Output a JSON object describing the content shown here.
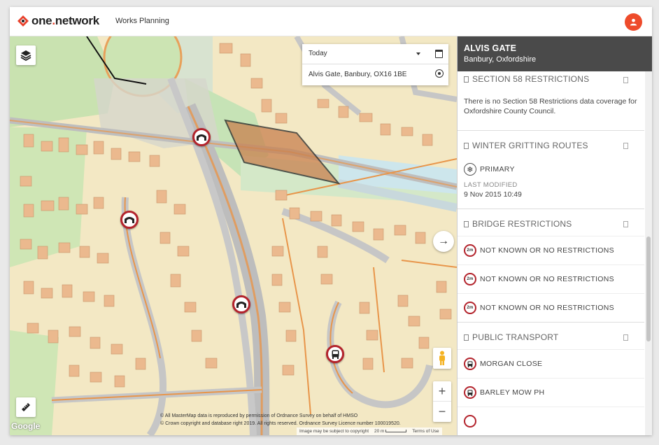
{
  "header": {
    "brand_prefix": "one",
    "brand_dot": ".",
    "brand_suffix": "network",
    "app_name": "Works Planning"
  },
  "search": {
    "date_value": "Today",
    "address_value": "Alvis Gate, Banbury, OX16 1BE"
  },
  "map": {
    "attribution_line1": "© All MasterMap data is reproduced by permission of Ordnance Survey on behalf of HMSO",
    "attribution_line2": "© Crown copyright and database right 2019. All rights reserved. Ordnance Survey Licence number 100019520.",
    "google_label": "Google",
    "footer_notice": "Image may be subject to copyright",
    "scale_label": "20 m",
    "terms_label": "Terms of Use",
    "zoom_in": "+",
    "zoom_out": "−",
    "expand_arrow": "→"
  },
  "panel": {
    "title": "ALVIS GATE",
    "subtitle": "Banbury, Oxfordshire",
    "sections": {
      "s58": {
        "title": "SECTION 58 RESTRICTIONS",
        "text": "There is no Section 58 Restrictions data coverage for Oxfordshire County Council."
      },
      "gritting": {
        "title": "WINTER GRITTING ROUTES",
        "value": "PRIMARY",
        "last_modified_label": "LAST MODIFIED",
        "last_modified_value": "9 Nov 2015 10:49"
      },
      "bridge": {
        "title": "BRIDGE RESTRICTIONS",
        "badge": "2m",
        "items": [
          "NOT KNOWN OR NO RESTRICTIONS",
          "NOT KNOWN OR NO RESTRICTIONS",
          "NOT KNOWN OR NO RESTRICTIONS"
        ]
      },
      "transport": {
        "title": "PUBLIC TRANSPORT",
        "items": [
          "MORGAN CLOSE",
          "BARLEY MOW PH"
        ]
      }
    }
  },
  "colors": {
    "brand_red": "#e8412c",
    "marker_red": "#b3232c",
    "panel_header": "#4a4a4a"
  }
}
